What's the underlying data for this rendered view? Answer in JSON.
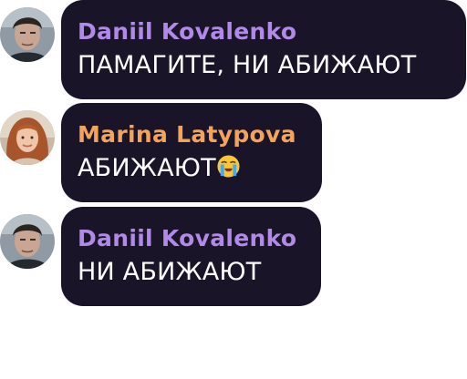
{
  "messages": [
    {
      "author": "Daniil Kovalenko",
      "author_color": "#b18ae8",
      "text": "ПАМАГИТЕ, НИ АБИЖАЮТ",
      "avatar": "avatar-daniil"
    },
    {
      "author": "Marina Latypova",
      "author_color": "#f3a35a",
      "text": "АБИЖАЮТ",
      "emoji": "loudly-crying-face-icon",
      "avatar": "avatar-marina"
    },
    {
      "author": "Daniil Kovalenko",
      "author_color": "#b18ae8",
      "text": "НИ АБИЖАЮТ",
      "avatar": "avatar-daniil"
    }
  ],
  "colors": {
    "bubble_background": "#1a1428",
    "message_text": "#ffffff",
    "page_background": "#ffffff"
  }
}
